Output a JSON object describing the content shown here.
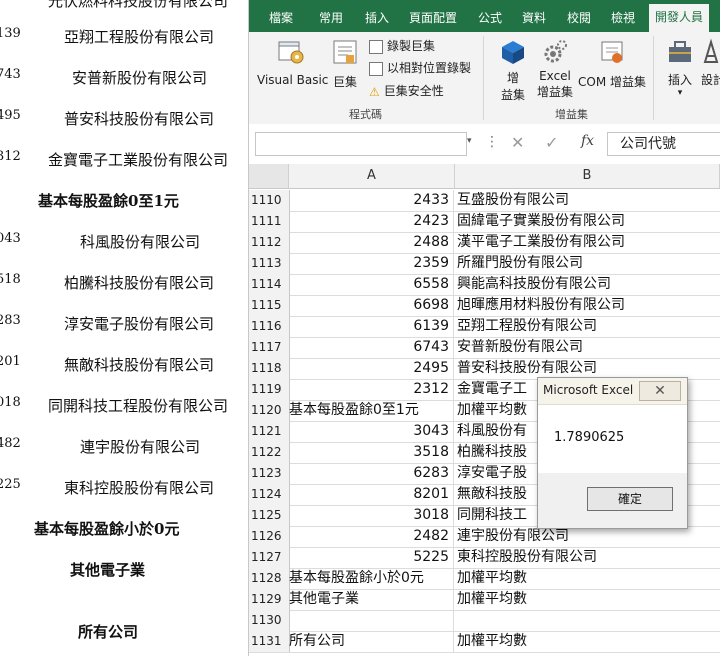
{
  "doc": {
    "top_fragment": "光伏燃料科技股份有限公司",
    "rows": [
      {
        "num": "139",
        "name": "亞翔工程股份有限公司"
      },
      {
        "num": "743",
        "name": "安普新股份有限公司"
      },
      {
        "num": "495",
        "name": "普安科技股份有限公司"
      },
      {
        "num": "312",
        "name": "金寶電子工業股份有限公司"
      }
    ],
    "heading_eps_0_1": "基本每股盈餘0至1元",
    "rows2": [
      {
        "num": "043",
        "name": "科風股份有限公司"
      },
      {
        "num": "518",
        "name": "柏騰科技股份有限公司"
      },
      {
        "num": "283",
        "name": "淳安電子股份有限公司"
      },
      {
        "num": "201",
        "name": "無敵科技股份有限公司"
      },
      {
        "num": "018",
        "name": "同開科技工程股份有限公司"
      },
      {
        "num": "482",
        "name": "連宇股份有限公司"
      },
      {
        "num": "225",
        "name": "東科控股股份有限公司"
      }
    ],
    "heading_eps_neg": "基本每股盈餘小於0元",
    "heading_other": "其他電子業",
    "heading_all": "所有公司"
  },
  "ribbon": {
    "tabs": [
      "檔案",
      "常用",
      "插入",
      "頁面配置",
      "公式",
      "資料",
      "校閱",
      "檢視",
      "開發人員"
    ],
    "active_tab": "開發人員",
    "visual_basic": "Visual Basic",
    "macros": "巨集",
    "record_macro": "錄製巨集",
    "relative_ref": "以相對位置錄製",
    "macro_security": "巨集安全性",
    "group_code": "程式碼",
    "addins_1": "增",
    "addins_2": "益集",
    "excel_addins_1": "Excel",
    "excel_addins_2": "增益集",
    "com_addins": "COM 增益集",
    "group_addins": "增益集",
    "insert": "插入",
    "design": "設計"
  },
  "formula_bar": {
    "fx": "fx",
    "content": "公司代號"
  },
  "columns": [
    "A",
    "B"
  ],
  "rows": [
    {
      "n": "1110",
      "a": "2433",
      "b": "互盛股份有限公司"
    },
    {
      "n": "1111",
      "a": "2423",
      "b": "固緯電子實業股份有限公司"
    },
    {
      "n": "1112",
      "a": "2488",
      "b": "漢平電子工業股份有限公司"
    },
    {
      "n": "1113",
      "a": "2359",
      "b": "所羅門股份有限公司"
    },
    {
      "n": "1114",
      "a": "6558",
      "b": "興能高科技股份有限公司"
    },
    {
      "n": "1115",
      "a": "6698",
      "b": "旭暉應用材料股份有限公司"
    },
    {
      "n": "1116",
      "a": "6139",
      "b": "亞翔工程股份有限公司"
    },
    {
      "n": "1117",
      "a": "6743",
      "b": "安普新股份有限公司"
    },
    {
      "n": "1118",
      "a": "2495",
      "b": "普安科技股份有限公司"
    },
    {
      "n": "1119",
      "a": "2312",
      "b": "金寶電子工"
    },
    {
      "n": "1120",
      "a": "基本每股盈餘0至1元",
      "b": "加權平均數"
    },
    {
      "n": "1121",
      "a": "3043",
      "b": "科風股份有"
    },
    {
      "n": "1122",
      "a": "3518",
      "b": "柏騰科技股"
    },
    {
      "n": "1123",
      "a": "6283",
      "b": "淳安電子股"
    },
    {
      "n": "1124",
      "a": "8201",
      "b": "無敵科技股"
    },
    {
      "n": "1125",
      "a": "3018",
      "b": "同開科技工"
    },
    {
      "n": "1126",
      "a": "2482",
      "b": "連宇股份有限公司"
    },
    {
      "n": "1127",
      "a": "5225",
      "b": "東科控股股份有限公司"
    },
    {
      "n": "1128",
      "a": "基本每股盈餘小於0元",
      "b": "加權平均數"
    },
    {
      "n": "1129",
      "a": "其他電子業",
      "b": "加權平均數"
    },
    {
      "n": "1130",
      "a": "",
      "b": ""
    },
    {
      "n": "1131",
      "a": "所有公司",
      "b": "加權平均數"
    }
  ],
  "dialog": {
    "title": "Microsoft Excel",
    "close": "✕",
    "message": "1.7890625",
    "ok": "確定"
  }
}
